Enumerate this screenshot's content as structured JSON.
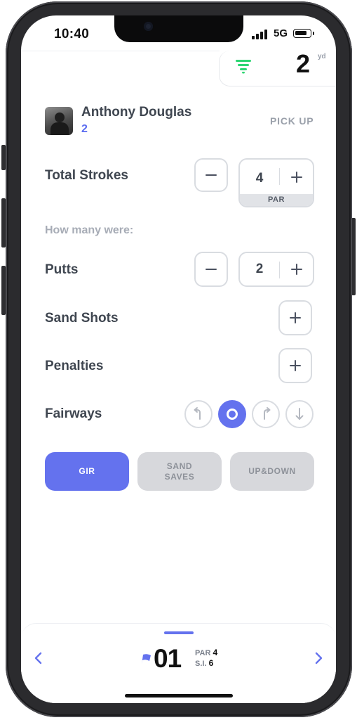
{
  "status_bar": {
    "time": "10:40",
    "network": "5G"
  },
  "header": {
    "yardage": "2",
    "yardage_unit": "yd"
  },
  "player": {
    "name": "Anthony Douglas",
    "sub_value": "2",
    "pick_up_label": "PICK UP"
  },
  "total_strokes": {
    "label": "Total Strokes",
    "value": "4",
    "par_label": "PAR"
  },
  "breakdown_hint": "How many were:",
  "putts": {
    "label": "Putts",
    "value": "2"
  },
  "sand_shots": {
    "label": "Sand Shots"
  },
  "penalties": {
    "label": "Penalties"
  },
  "fairways": {
    "label": "Fairways",
    "selected": "hit"
  },
  "stats": {
    "gir_label": "GIR",
    "gir_selected": true,
    "sand_saves_line1": "SAND",
    "sand_saves_line2": "SAVES",
    "sand_saves_selected": false,
    "up_down_label": "UP&DOWN",
    "up_down_selected": false
  },
  "hole": {
    "number": "01",
    "par_label": "PAR",
    "par_value": "4",
    "si_label": "S.I.",
    "si_value": "6"
  },
  "colors": {
    "accent": "#6472ee",
    "filter_green": "#2ed573",
    "inactive": "#d7d8dc"
  }
}
